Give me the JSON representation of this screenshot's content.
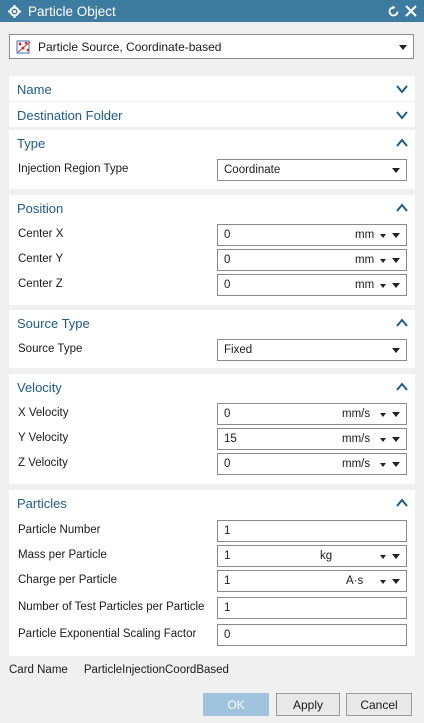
{
  "window": {
    "title": "Particle Object"
  },
  "object_type": {
    "value": "Particle Source, Coordinate-based"
  },
  "groups": {
    "name": {
      "title": "Name"
    },
    "destination": {
      "title": "Destination Folder"
    },
    "type": {
      "title": "Type",
      "injection_region_type": {
        "label": "Injection Region Type",
        "value": "Coordinate"
      }
    },
    "position": {
      "title": "Position",
      "center_x": {
        "label": "Center X",
        "value": "0",
        "unit": "mm"
      },
      "center_y": {
        "label": "Center Y",
        "value": "0",
        "unit": "mm"
      },
      "center_z": {
        "label": "Center Z",
        "value": "0",
        "unit": "mm"
      }
    },
    "source_type": {
      "title": "Source Type",
      "source_type": {
        "label": "Source Type",
        "value": "Fixed"
      }
    },
    "velocity": {
      "title": "Velocity",
      "x": {
        "label": "X Velocity",
        "value": "0",
        "unit": "mm/s"
      },
      "y": {
        "label": "Y Velocity",
        "value": "15",
        "unit": "mm/s"
      },
      "z": {
        "label": "Z Velocity",
        "value": "0",
        "unit": "mm/s"
      }
    },
    "particles": {
      "title": "Particles",
      "particle_number": {
        "label": "Particle Number",
        "value": "1"
      },
      "mass": {
        "label": "Mass per Particle",
        "value": "1",
        "unit": "kg"
      },
      "charge": {
        "label": "Charge per Particle",
        "value": "1",
        "unit": "A·s"
      },
      "test_particles": {
        "label": "Number of Test Particles per Particle",
        "value": "1"
      },
      "scaling": {
        "label": "Particle Exponential Scaling Factor",
        "value": "0"
      }
    }
  },
  "card_name": {
    "label": "Card Name",
    "value": "ParticleInjectionCoordBased"
  },
  "buttons": {
    "ok": "OK",
    "apply": "Apply",
    "cancel": "Cancel"
  },
  "colors": {
    "titlebar": "#3e7ba0",
    "group_title": "#1c5b87",
    "ok_button": "#9fc3dc"
  }
}
